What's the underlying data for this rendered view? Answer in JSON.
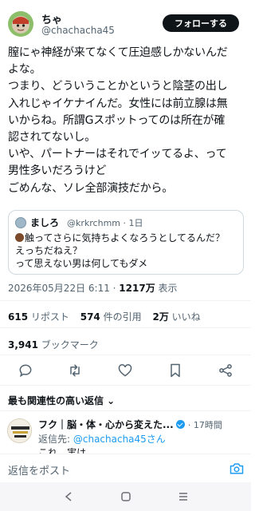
{
  "post": {
    "author_name": "ちゃ",
    "author_handle": "@chachacha45",
    "follow_label": "フォローする",
    "lines": [
      "膣にゃ神経が来てなくて圧迫感しかないんだ",
      "よな。",
      "つまり、どういうことかというと陰茎の出し",
      "入れじゃイケナイんだ。女性には前立腺は無",
      "いからね。所謂Gスポットってのは所在が確",
      "認されてないし。",
      "いや、パートナーはそれでイッてるよ、って",
      "男性多いだろうけど",
      "ごめんな、ソレ全部演技だから。"
    ],
    "timestamp": "2026年05月22日 6:11",
    "views_count": "1217万",
    "views_label": "表示"
  },
  "quoted": {
    "name": "ましろ",
    "handle_time": "@krkrchmm · 1日",
    "lines": [
      "触ってさらに気持ちよくなろうとしてるんだ？",
      "えっちだねえ？",
      "って思えない男は何してもダメ"
    ]
  },
  "stats": {
    "reposts_count": "615",
    "reposts_label": "リポスト",
    "quotes_count": "574",
    "quotes_label": "件の引用",
    "likes_count": "2万",
    "likes_label": "いいね",
    "bookmarks_count": "3,941",
    "bookmarks_label": "ブックマーク"
  },
  "actions": {
    "icons": [
      "reply-icon",
      "repost-icon",
      "like-icon",
      "bookmark-icon",
      "share-icon"
    ]
  },
  "replies_sort": {
    "label": "最も関連性の高い返信 ⌄"
  },
  "reply": {
    "name": "フク｜脳・体・心から変えた...",
    "time": "· 17時間",
    "replying_to_prefix": "返信先: ",
    "replying_to_link": "@chachacha45さん",
    "snippet": "これ、実は"
  },
  "composer": {
    "placeholder": "返信をポスト"
  },
  "colors": {
    "accent": "#1d9bf0",
    "text": "#0f1419",
    "secondary": "#536471",
    "border": "#cfd9de"
  }
}
